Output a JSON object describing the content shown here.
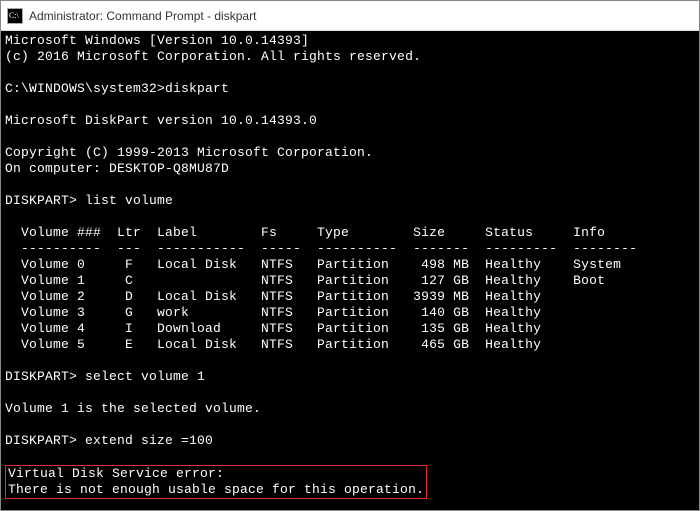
{
  "window": {
    "title": "Administrator: Command Prompt - diskpart"
  },
  "banner": {
    "line1": "Microsoft Windows [Version 10.0.14393]",
    "line2": "(c) 2016 Microsoft Corporation. All rights reserved."
  },
  "prompt1": {
    "prefix": "C:\\WINDOWS\\system32>",
    "cmd": "diskpart"
  },
  "dp_version": "Microsoft DiskPart version 10.0.14393.0",
  "copyright": "Copyright (C) 1999-2013 Microsoft Corporation.",
  "computer": "On computer: DESKTOP-Q8MU87D",
  "prompt2": {
    "prefix": "DISKPART>",
    "cmd": " list volume"
  },
  "table": {
    "header": "  Volume ###  Ltr  Label        Fs     Type        Size     Status     Info",
    "divider": "  ----------  ---  -----------  -----  ----------  -------  ---------  --------",
    "rows": [
      "  Volume 0     F   Local Disk   NTFS   Partition    498 MB  Healthy    System",
      "  Volume 1     C                NTFS   Partition    127 GB  Healthy    Boot",
      "  Volume 2     D   Local Disk   NTFS   Partition   3939 MB  Healthy",
      "  Volume 3     G   work         NTFS   Partition    140 GB  Healthy",
      "  Volume 4     I   Download     NTFS   Partition    135 GB  Healthy",
      "  Volume 5     E   Local Disk   NTFS   Partition    465 GB  Healthy"
    ]
  },
  "prompt3": {
    "prefix": "DISKPART>",
    "cmd": " select volume 1"
  },
  "selected_msg": "Volume 1 is the selected volume.",
  "prompt4": {
    "prefix": "DISKPART>",
    "cmd": " extend size =100"
  },
  "error": {
    "line1": "Virtual Disk Service error:",
    "line2": "There is not enough usable space for this operation."
  }
}
